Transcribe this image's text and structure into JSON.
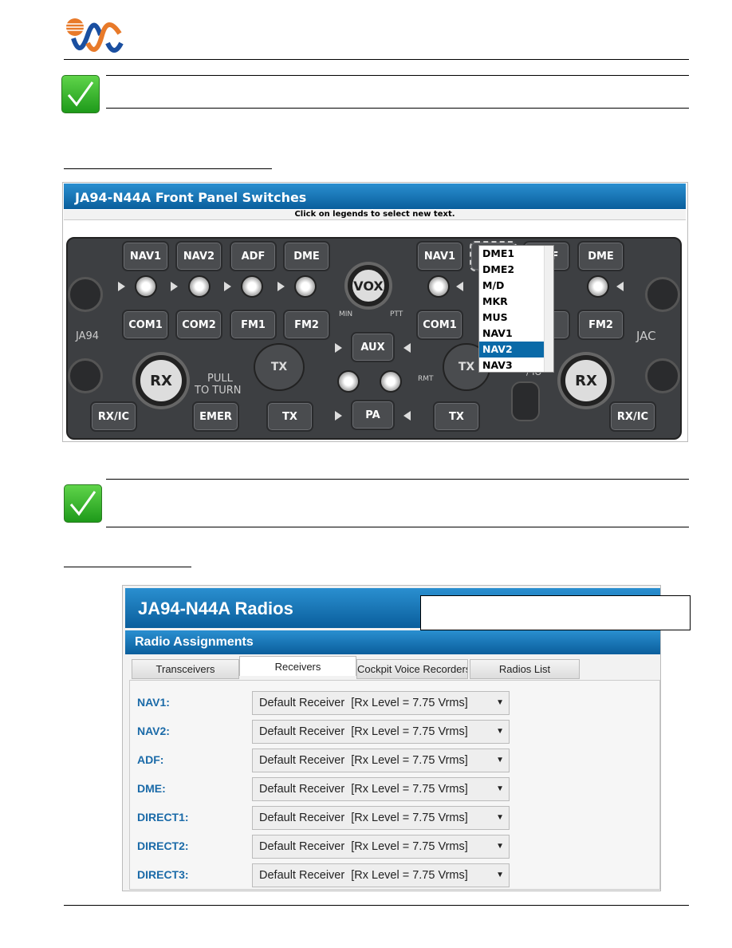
{
  "panel_screenshot": {
    "title": "JA94-N44A Front Panel Switches",
    "instruction": "Click on legends to select new text.",
    "left_top_buttons": [
      "NAV1",
      "NAV2",
      "ADF",
      "DME"
    ],
    "left_mid_buttons": [
      "COM1",
      "COM2",
      "FM1",
      "FM2"
    ],
    "right_top_buttons": [
      "NAV1",
      "",
      "ADF",
      "DME"
    ],
    "right_mid_buttons": [
      "COM1",
      "FM2"
    ],
    "center_buttons": {
      "aux": "AUX",
      "pa": "PA"
    },
    "bottom_buttons": {
      "rxic_left": "RX/IC",
      "emer": "EMER",
      "tx_left": "TX",
      "tx_right": "TX",
      "rxic_right": "RX/IC"
    },
    "knobs": {
      "vox": "VOX",
      "rx_left": "RX",
      "rx_right": "RX",
      "tx_left": "TX",
      "tx_right": "TX"
    },
    "labels": {
      "min": "MIN",
      "ptt": "PTT",
      "model": "JA94",
      "pull": "PULL",
      "to_turn": "TO TURN",
      "rmt": "RMT",
      "brand": "JAC",
      "io": "/ IO"
    },
    "dropdown": {
      "options": [
        "DME1",
        "DME2",
        "M/D",
        "MKR",
        "MUS",
        "NAV1",
        "NAV2",
        "NAV3"
      ],
      "selected": "NAV2"
    }
  },
  "radios_screenshot": {
    "title": "JA94-N44A Radios",
    "section": "Radio Assignments",
    "tabs": [
      "Transceivers",
      "Receivers",
      "Cockpit Voice Recorders",
      "Radios List"
    ],
    "active_tab": "Receivers",
    "rows": [
      {
        "label": "NAV1:",
        "value": "Default Receiver  [Rx Level = 7.75 Vrms]"
      },
      {
        "label": "NAV2:",
        "value": "Default Receiver  [Rx Level = 7.75 Vrms]"
      },
      {
        "label": "ADF:",
        "value": "Default Receiver  [Rx Level = 7.75 Vrms]"
      },
      {
        "label": "DME:",
        "value": "Default Receiver  [Rx Level = 7.75 Vrms]"
      },
      {
        "label": "DIRECT1:",
        "value": "Default Receiver  [Rx Level = 7.75 Vrms]"
      },
      {
        "label": "DIRECT2:",
        "value": "Default Receiver  [Rx Level = 7.75 Vrms]"
      },
      {
        "label": "DIRECT3:",
        "value": "Default Receiver  [Rx Level = 7.75 Vrms]"
      }
    ]
  },
  "colors": {
    "header_blue": "#0a6aa8",
    "label_blue": "#1a6aa8",
    "check_green": "#2fb52a"
  }
}
